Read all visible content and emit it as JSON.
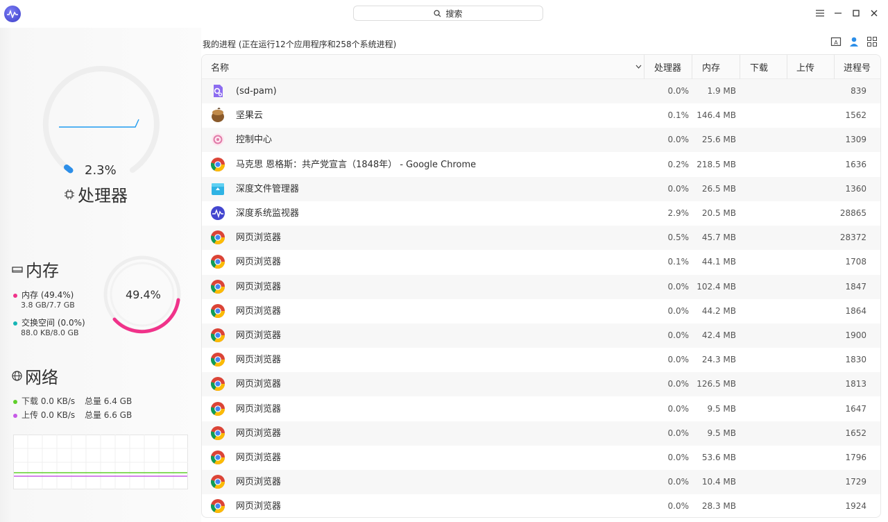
{
  "app": {
    "search_label": "搜索"
  },
  "sidebar": {
    "cpu": {
      "percent_text": "2.3%",
      "label": "处理器",
      "usage_fraction": 0.023
    },
    "memory": {
      "title": "内存",
      "percent_text": "49.4%",
      "usage_fraction": 0.494,
      "mem_label": "内存 (49.4%)",
      "mem_detail": "3.8 GB/7.7 GB",
      "swap_label": "交换空间 (0.0%)",
      "swap_detail": "88.0 KB/8.0 GB",
      "mem_color": "#f0338a",
      "swap_color": "#16b5b5"
    },
    "network": {
      "title": "网络",
      "download_label": "下载 0.0 KB/s",
      "download_total": "总量 6.4 GB",
      "upload_label": "上传 0.0 KB/s",
      "upload_total": "总量 6.6 GB",
      "download_color": "#5fcf2a",
      "upload_color": "#c659e6"
    }
  },
  "main": {
    "title": "我的进程 (正在运行12个应用程序和258个系统进程)",
    "columns": {
      "name": "名称",
      "cpu": "处理器",
      "memory": "内存",
      "download": "下载",
      "upload": "上传",
      "pid": "进程号"
    },
    "rows": [
      {
        "icon": "settings-gear-app-icon",
        "name": "(sd-pam)",
        "cpu": "0.0%",
        "mem": "1.9 MB",
        "pid": "839"
      },
      {
        "icon": "nutstore-acorn-icon",
        "name": "坚果云",
        "cpu": "0.1%",
        "mem": "146.4 MB",
        "pid": "1562"
      },
      {
        "icon": "control-center-icon",
        "name": "控制中心",
        "cpu": "0.0%",
        "mem": "25.6 MB",
        "pid": "1309"
      },
      {
        "icon": "chrome-icon",
        "name": "马克思 恩格斯：共产党宣言（1848年） - Google Chrome",
        "cpu": "0.2%",
        "mem": "218.5 MB",
        "pid": "1636"
      },
      {
        "icon": "file-manager-icon",
        "name": "深度文件管理器",
        "cpu": "0.0%",
        "mem": "26.5 MB",
        "pid": "1360"
      },
      {
        "icon": "system-monitor-icon",
        "name": "深度系统监视器",
        "cpu": "2.9%",
        "mem": "20.5 MB",
        "pid": "28865"
      },
      {
        "icon": "chrome-icon",
        "name": "网页浏览器",
        "cpu": "0.5%",
        "mem": "45.7 MB",
        "pid": "28372"
      },
      {
        "icon": "chrome-icon",
        "name": "网页浏览器",
        "cpu": "0.1%",
        "mem": "44.1 MB",
        "pid": "1708"
      },
      {
        "icon": "chrome-icon",
        "name": "网页浏览器",
        "cpu": "0.0%",
        "mem": "102.4 MB",
        "pid": "1847"
      },
      {
        "icon": "chrome-icon",
        "name": "网页浏览器",
        "cpu": "0.0%",
        "mem": "44.2 MB",
        "pid": "1864"
      },
      {
        "icon": "chrome-icon",
        "name": "网页浏览器",
        "cpu": "0.0%",
        "mem": "42.4 MB",
        "pid": "1900"
      },
      {
        "icon": "chrome-icon",
        "name": "网页浏览器",
        "cpu": "0.0%",
        "mem": "24.3 MB",
        "pid": "1830"
      },
      {
        "icon": "chrome-icon",
        "name": "网页浏览器",
        "cpu": "0.0%",
        "mem": "126.5 MB",
        "pid": "1813"
      },
      {
        "icon": "chrome-icon",
        "name": "网页浏览器",
        "cpu": "0.0%",
        "mem": "9.5 MB",
        "pid": "1647"
      },
      {
        "icon": "chrome-icon",
        "name": "网页浏览器",
        "cpu": "0.0%",
        "mem": "9.5 MB",
        "pid": "1652"
      },
      {
        "icon": "chrome-icon",
        "name": "网页浏览器",
        "cpu": "0.0%",
        "mem": "53.6 MB",
        "pid": "1796"
      },
      {
        "icon": "chrome-icon",
        "name": "网页浏览器",
        "cpu": "0.0%",
        "mem": "10.4 MB",
        "pid": "1729"
      },
      {
        "icon": "chrome-icon",
        "name": "网页浏览器",
        "cpu": "0.0%",
        "mem": "28.3 MB",
        "pid": "1924"
      }
    ]
  }
}
